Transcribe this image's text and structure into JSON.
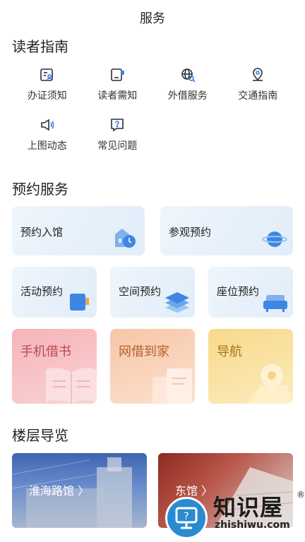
{
  "header": {
    "title": "服务"
  },
  "guide": {
    "title": "读者指南",
    "items": [
      {
        "label": "办证须知",
        "icon": "id-card-icon"
      },
      {
        "label": "读者需知",
        "icon": "notebook-icon"
      },
      {
        "label": "外借服务",
        "icon": "globe-search-icon"
      },
      {
        "label": "交通指南",
        "icon": "location-pin-icon"
      },
      {
        "label": "上图动态",
        "icon": "speaker-icon"
      },
      {
        "label": "常见问题",
        "icon": "question-icon"
      }
    ]
  },
  "reservation": {
    "title": "预约服务",
    "items": [
      {
        "label": "预约入馆"
      },
      {
        "label": "参观预约"
      },
      {
        "label": "活动预约"
      },
      {
        "label": "空间预约"
      },
      {
        "label": "座位预约"
      }
    ]
  },
  "features": {
    "items": [
      {
        "label": "手机借书"
      },
      {
        "label": "网借到家"
      },
      {
        "label": "导航"
      }
    ]
  },
  "floors": {
    "title": "楼层导览",
    "items": [
      {
        "label": "淮海路馆 〉"
      },
      {
        "label": "东馆 〉"
      }
    ]
  },
  "watermark": {
    "text": "知识屋",
    "url": "zhishiwu.com",
    "reg": "®"
  },
  "colors": {
    "accent": "#2f7de1",
    "icon_line": "#2b2f3a"
  }
}
